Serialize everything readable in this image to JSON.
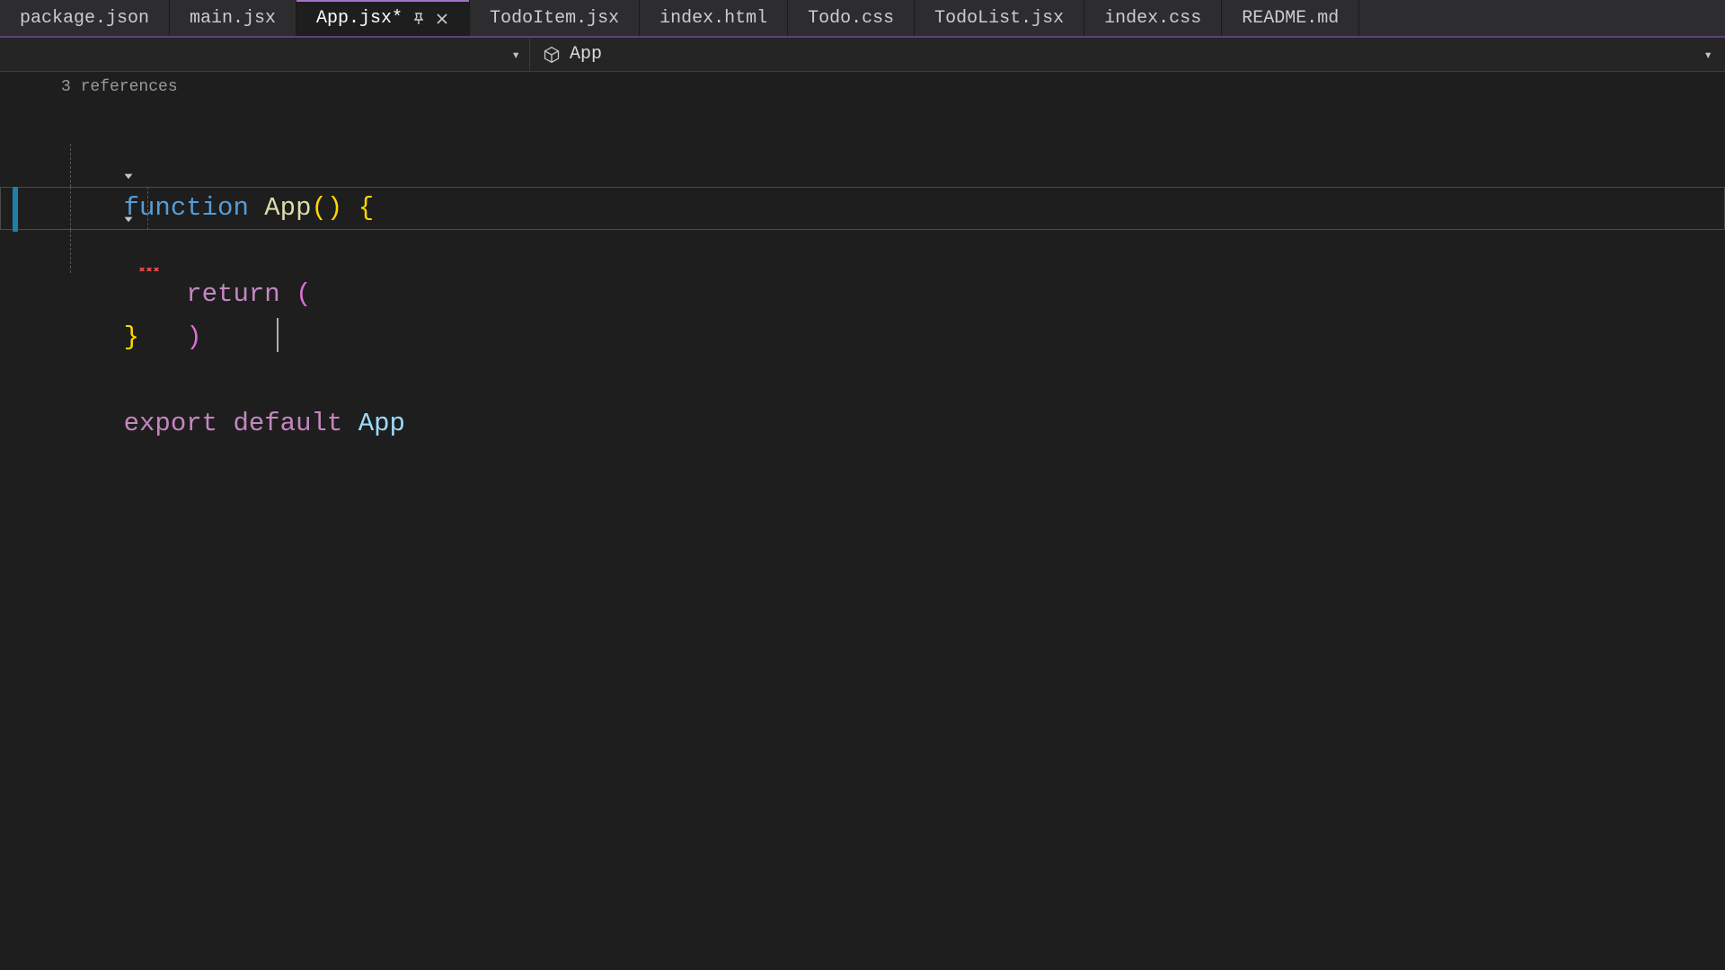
{
  "tabs": [
    {
      "label": "package.json",
      "active": false
    },
    {
      "label": "main.jsx",
      "active": false
    },
    {
      "label": "App.jsx*",
      "active": true,
      "pinned": true,
      "closable": true
    },
    {
      "label": "TodoItem.jsx",
      "active": false
    },
    {
      "label": "index.html",
      "active": false
    },
    {
      "label": "Todo.css",
      "active": false
    },
    {
      "label": "TodoList.jsx",
      "active": false
    },
    {
      "label": "index.css",
      "active": false
    },
    {
      "label": "README.md",
      "active": false
    }
  ],
  "breadcrumb": {
    "symbol": "App"
  },
  "codelens": {
    "references": "3 references"
  },
  "code": {
    "l1": {
      "kw": "function",
      "sp": " ",
      "fn": "App",
      "po": "(",
      "pc": ")",
      "sp2": " ",
      "bo": "{"
    },
    "l2": {
      "indent": "    ",
      "kw": "return",
      "sp": " ",
      "po": "("
    },
    "l3_cursor": "",
    "l4": {
      "indent": "    ",
      "pc": ")"
    },
    "l5": {
      "bc": "}"
    },
    "l7": {
      "kw1": "export",
      "sp1": " ",
      "kw2": "default",
      "sp2": " ",
      "id": "App"
    }
  }
}
